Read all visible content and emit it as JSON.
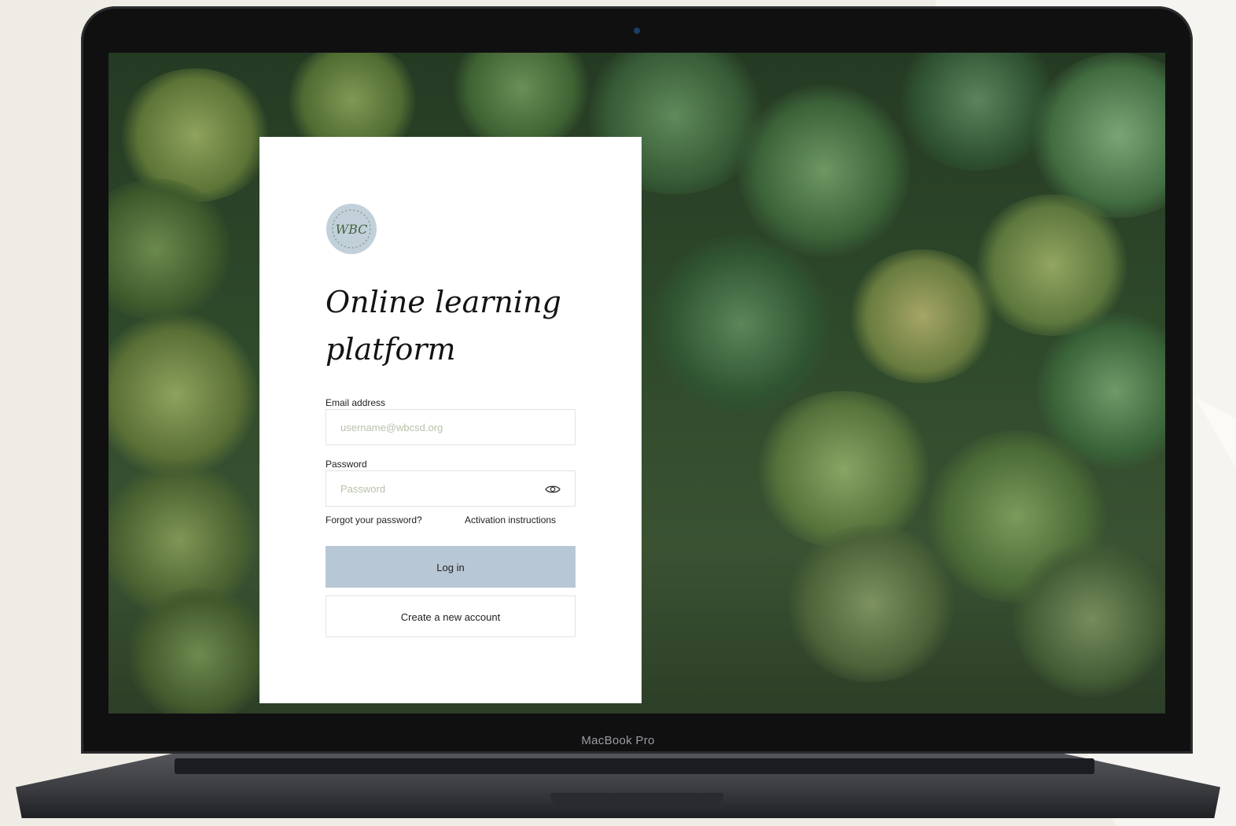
{
  "device": {
    "model_label": "MacBook Pro"
  },
  "login": {
    "logo_icon": "wbc-academy-seal-icon",
    "logo_text": "WBC",
    "title": "Online learning platform",
    "email": {
      "label": "Email address",
      "placeholder": "username@wbcsd.org"
    },
    "password": {
      "label": "Password",
      "placeholder": "Password",
      "toggle_icon": "eye-icon"
    },
    "forgot_link": "Forgot your password?",
    "activation_link": "Activation instructions",
    "login_button": "Log in",
    "create_account_button": "Create a new account"
  },
  "colors": {
    "primary_button": "#b8c7d5",
    "forest_background": "#2f4a2b",
    "logo_badge": "#c2d0da"
  }
}
